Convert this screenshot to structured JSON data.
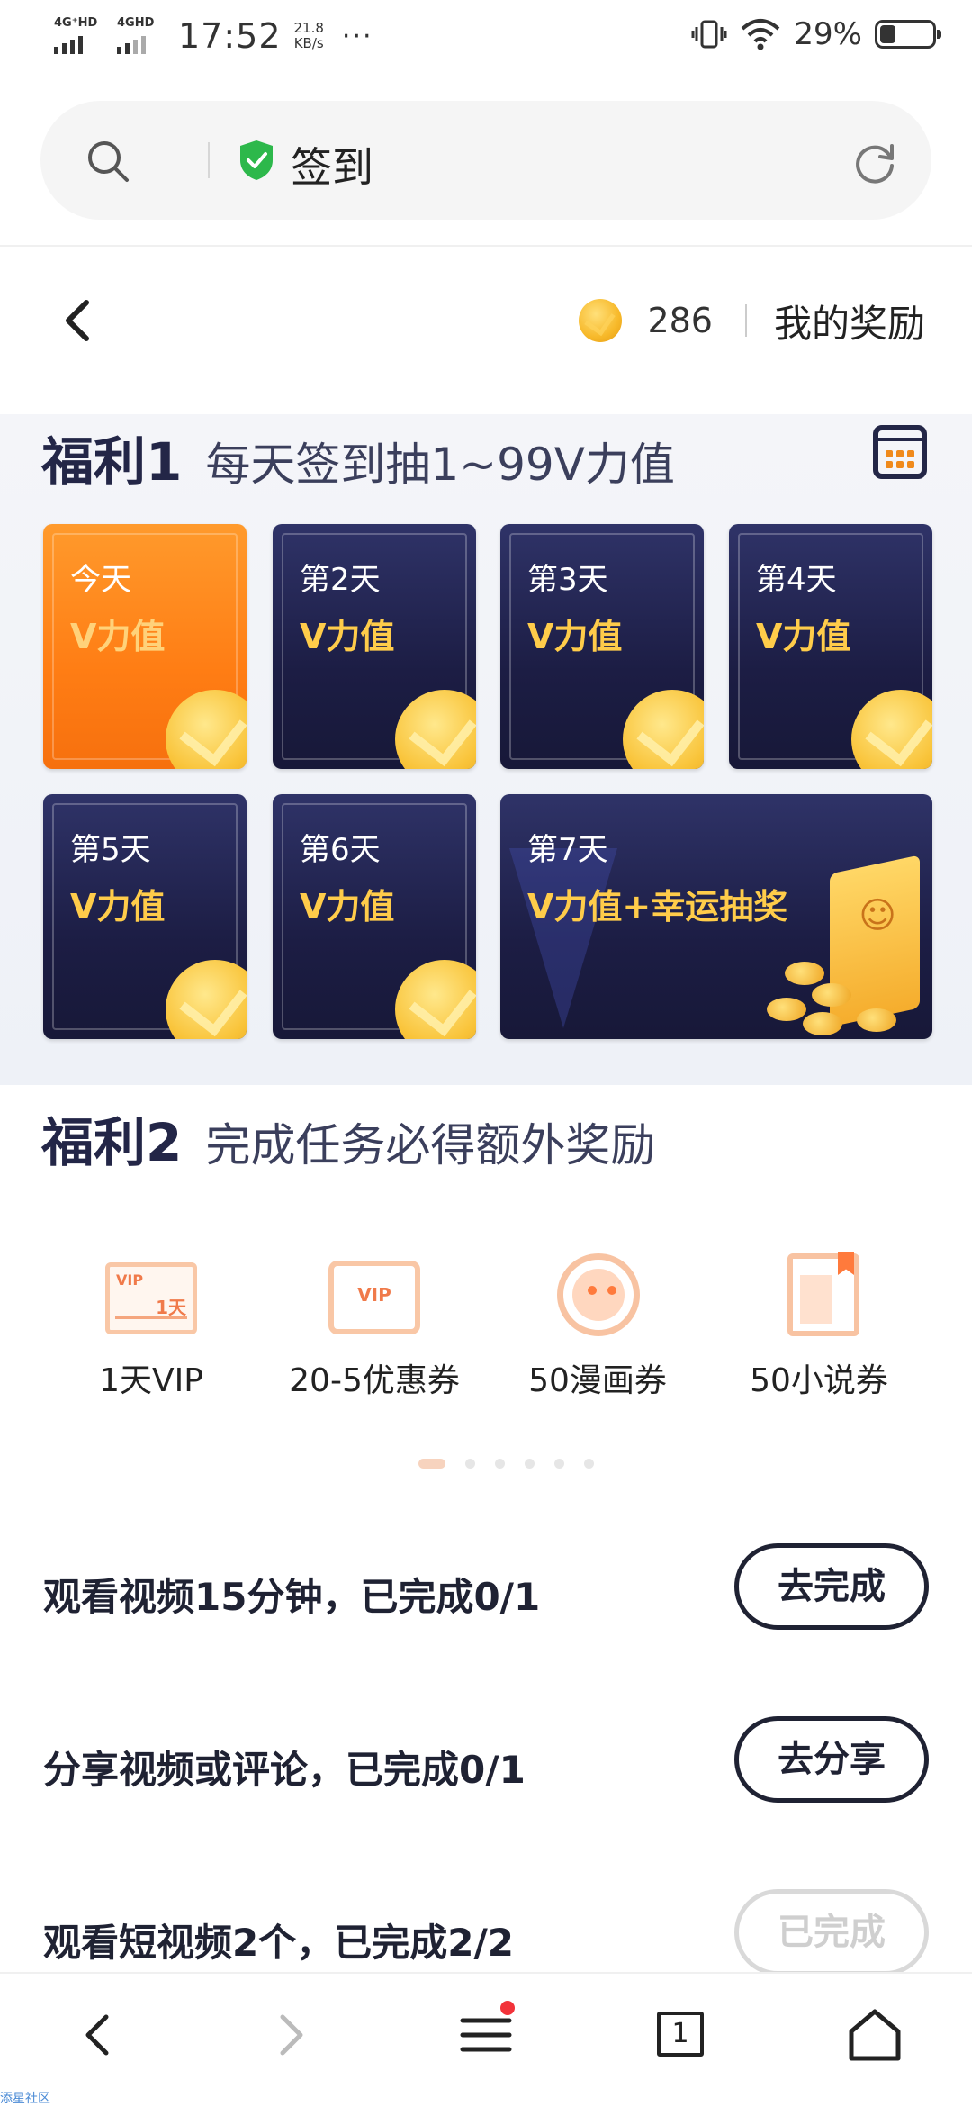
{
  "status_bar": {
    "net1": "4G⁺HD",
    "net2": "4GHD",
    "time": "17:52",
    "speed_value": "21.8",
    "speed_unit": "KB/s",
    "more": "···",
    "battery": "29%"
  },
  "address_bar": {
    "title": "签到",
    "icons": [
      "search-icon",
      "shield-check-icon",
      "reload-icon"
    ],
    "shield_color": "#2db84b"
  },
  "header": {
    "coins": "286",
    "my_rewards": "我的奖励"
  },
  "welfare1": {
    "label": "福利1",
    "subtitle": "每天签到抽1~99V力值",
    "days": [
      {
        "label": "今天",
        "value": "V力值"
      },
      {
        "label": "第2天",
        "value": "V力值"
      },
      {
        "label": "第3天",
        "value": "V力值"
      },
      {
        "label": "第4天",
        "value": "V力值"
      },
      {
        "label": "第5天",
        "value": "V力值"
      },
      {
        "label": "第6天",
        "value": "V力值"
      },
      {
        "label": "第7天",
        "value": "V力值+幸运抽奖"
      }
    ],
    "accent": "#ff7d14"
  },
  "welfare2": {
    "label": "福利2",
    "subtitle": "完成任务必得额外奖励",
    "rewards": [
      {
        "label": "1天VIP",
        "icon": "vip-ticket-icon",
        "icon_text_1": "VIP",
        "icon_text_2": "1天"
      },
      {
        "label": "20-5优惠券",
        "icon": "coupon-icon",
        "icon_text_1": "VIP"
      },
      {
        "label": "50漫画券",
        "icon": "manga-icon"
      },
      {
        "label": "50小说券",
        "icon": "novel-icon"
      }
    ],
    "carousel_pages": 6,
    "carousel_active": 1
  },
  "tasks": [
    {
      "text": "观看视频15分钟，已完成0/1",
      "button": "去完成",
      "done": false
    },
    {
      "text": "分享视频或评论，已完成0/1",
      "button": "去分享",
      "done": false
    },
    {
      "text": "观看短视频2个，已完成2/2",
      "button": "已完成",
      "done": true
    }
  ],
  "bottom_nav": {
    "tab_count": "1",
    "items": [
      "back-icon",
      "forward-icon",
      "menu-icon",
      "tabs-icon",
      "home-icon"
    ]
  },
  "watermark": "添星社区"
}
